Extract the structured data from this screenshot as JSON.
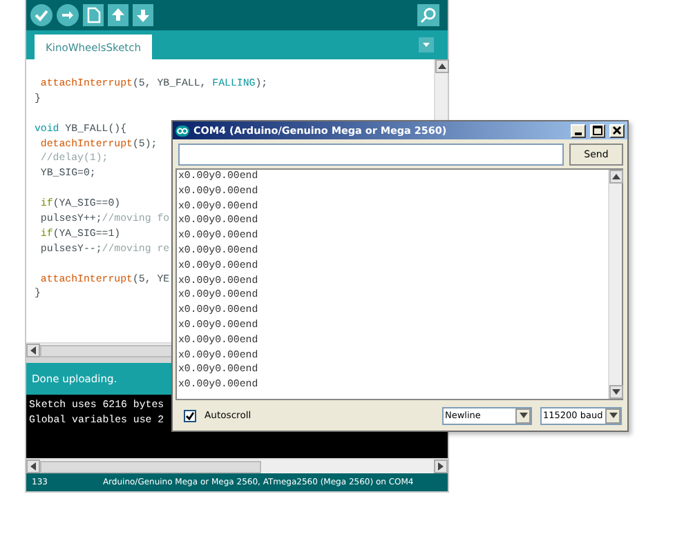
{
  "ide": {
    "tabs": [
      {
        "label": "KinoWheelsSketch",
        "selected": true
      }
    ],
    "code_lines": [
      {
        "kind": "code",
        "segments": [
          {
            "text": " attachInterrupt",
            "kind": "function"
          },
          {
            "text": "(5, YB_FALL, ",
            "kind": "plain"
          },
          {
            "text": "FALLING",
            "kind": "constant"
          },
          {
            "text": ");",
            "kind": "plain"
          }
        ]
      },
      {
        "kind": "code",
        "segments": [
          {
            "text": "}",
            "kind": "plain"
          }
        ]
      },
      {
        "kind": "blank"
      },
      {
        "kind": "code",
        "segments": [
          {
            "text": "void",
            "kind": "keyword"
          },
          {
            "text": " YB_FALL(){",
            "kind": "plain"
          }
        ]
      },
      {
        "kind": "code",
        "segments": [
          {
            "text": " detachInterrupt",
            "kind": "function"
          },
          {
            "text": "(5);",
            "kind": "plain"
          }
        ]
      },
      {
        "kind": "code",
        "segments": [
          {
            "text": " //delay(1);",
            "kind": "comment"
          }
        ]
      },
      {
        "kind": "code",
        "segments": [
          {
            "text": " YB_SIG=0;",
            "kind": "plain"
          }
        ]
      },
      {
        "kind": "blank"
      },
      {
        "kind": "code",
        "segments": [
          {
            "text": " if",
            "kind": "control"
          },
          {
            "text": "(YA_SIG==0)",
            "kind": "plain"
          }
        ]
      },
      {
        "kind": "code",
        "segments": [
          {
            "text": " pulsesY++;",
            "kind": "plain"
          },
          {
            "text": "//moving fo",
            "kind": "comment"
          }
        ]
      },
      {
        "kind": "code",
        "segments": [
          {
            "text": " if",
            "kind": "control"
          },
          {
            "text": "(YA_SIG==1)",
            "kind": "plain"
          }
        ]
      },
      {
        "kind": "code",
        "segments": [
          {
            "text": " pulsesY--;",
            "kind": "plain"
          },
          {
            "text": "//moving re",
            "kind": "comment"
          }
        ]
      },
      {
        "kind": "blank"
      },
      {
        "kind": "code",
        "segments": [
          {
            "text": " attachInterrupt",
            "kind": "function"
          },
          {
            "text": "(5, YE",
            "kind": "plain"
          }
        ]
      },
      {
        "kind": "code",
        "segments": [
          {
            "text": "}",
            "kind": "plain"
          }
        ]
      }
    ],
    "status": "Done uploading.",
    "console_lines": [
      "Sketch uses 6216 bytes",
      "Global variables use 2"
    ],
    "footer": {
      "line": "133",
      "board": "Arduino/Genuino Mega or Mega 2560, ATmega2560 (Mega 2560) on COM4"
    }
  },
  "serial_monitor": {
    "title": "COM4 (Arduino/Genuino Mega or Mega 2560)",
    "send_button": "Send",
    "output_lines": [
      "x0.00y0.00end",
      "x0.00y0.00end",
      "x0.00y0.00end",
      "x0.00y0.00end",
      "x0.00y0.00end",
      "x0.00y0.00end",
      "x0.00y0.00end",
      "x0.00y0.00end",
      "x0.00y0.00end",
      "x0.00y0.00end",
      "x0.00y0.00end",
      "x0.00y0.00end",
      "x0.00y0.00end",
      "x0.00y0.00end",
      "x0.00y0.00end"
    ],
    "autoscroll": {
      "label": "Autoscroll",
      "checked": true
    },
    "line_ending": "Newline",
    "baud_rate": "115200 baud"
  }
}
